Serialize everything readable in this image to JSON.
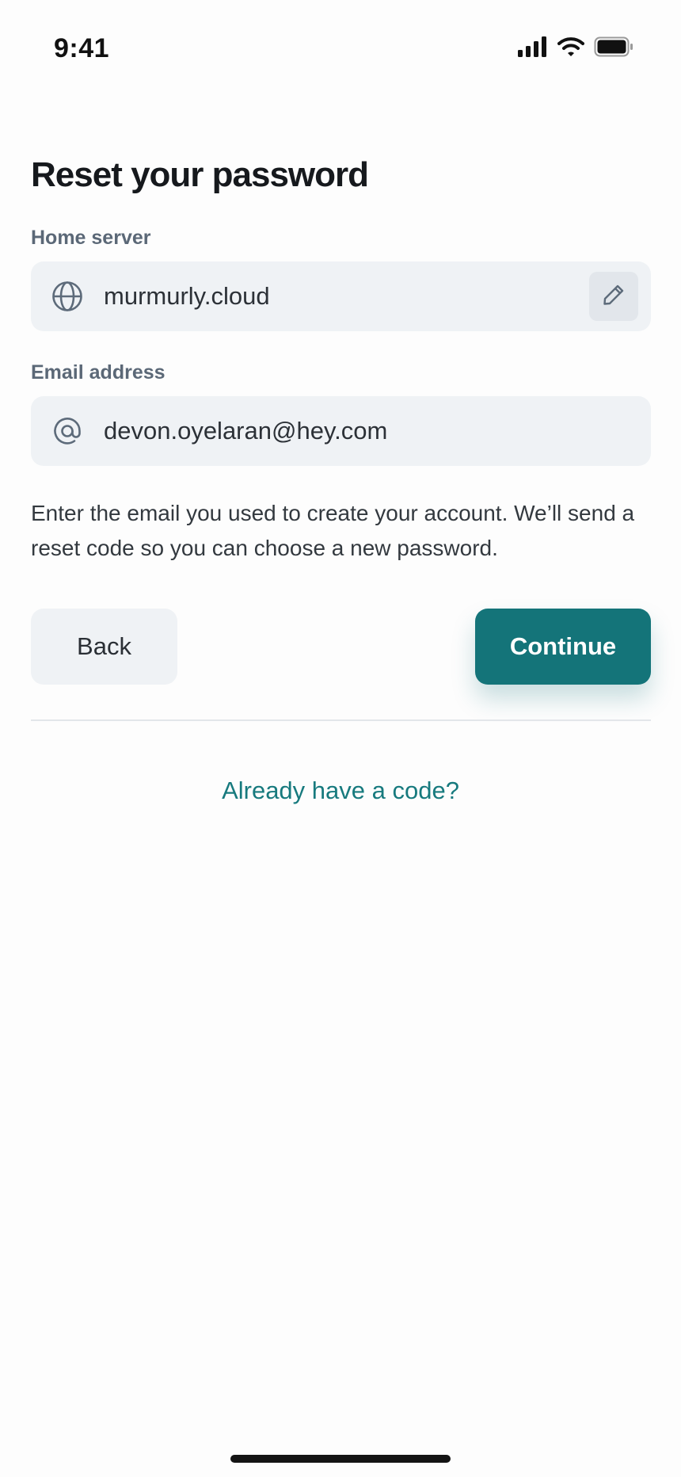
{
  "status_bar": {
    "time": "9:41",
    "icons": [
      "signal-icon",
      "wifi-icon",
      "battery-icon"
    ]
  },
  "page": {
    "title": "Reset your password"
  },
  "home_server": {
    "label": "Home server",
    "value": "murmurly.cloud",
    "icon": "globe-icon",
    "edit_icon": "pencil-icon"
  },
  "email": {
    "label": "Email address",
    "value": "devon.oyelaran@hey.com",
    "icon": "at-icon"
  },
  "help_text": "Enter the email you used to create your account. We’ll send a reset code so you can choose a new password.",
  "actions": {
    "back_label": "Back",
    "continue_label": "Continue"
  },
  "code_link": "Already have a code?",
  "colors": {
    "accent": "#147479",
    "link": "#177a7e",
    "field_bg": "#eff2f5",
    "label": "#5b6877"
  }
}
